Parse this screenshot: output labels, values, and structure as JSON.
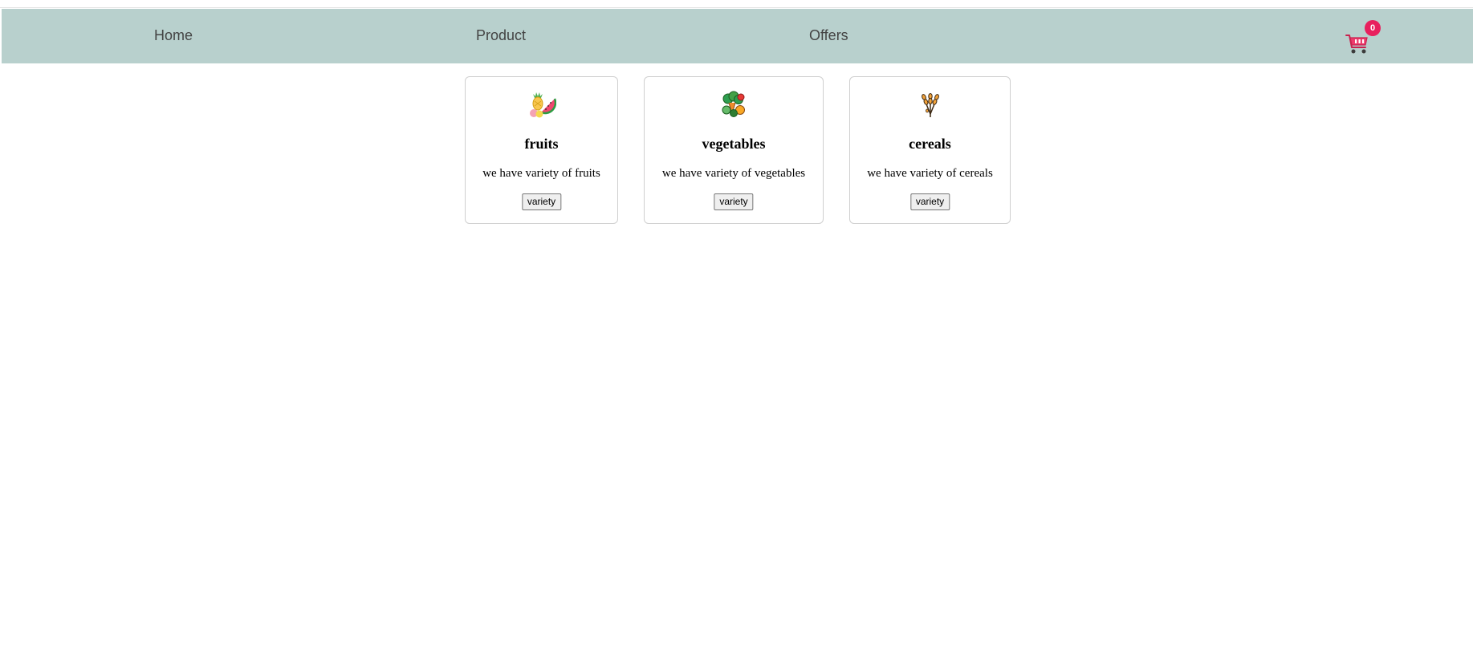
{
  "nav": {
    "home_label": "Home",
    "product_label": "Product",
    "offers_label": "Offers",
    "cart_count": "0",
    "cart_icon": "shopping-cart-icon",
    "background_color": "#b8d0cd",
    "badge_color": "#e8205e"
  },
  "cards": [
    {
      "icon": "fruits-icon",
      "title": "fruits",
      "description": "we have variety of fruits",
      "button_label": "variety"
    },
    {
      "icon": "vegetables-icon",
      "title": "vegetables",
      "description": "we have variety of vegetables",
      "button_label": "variety"
    },
    {
      "icon": "cereals-icon",
      "title": "cereals",
      "description": "we have variety of cereals",
      "button_label": "variety"
    }
  ]
}
